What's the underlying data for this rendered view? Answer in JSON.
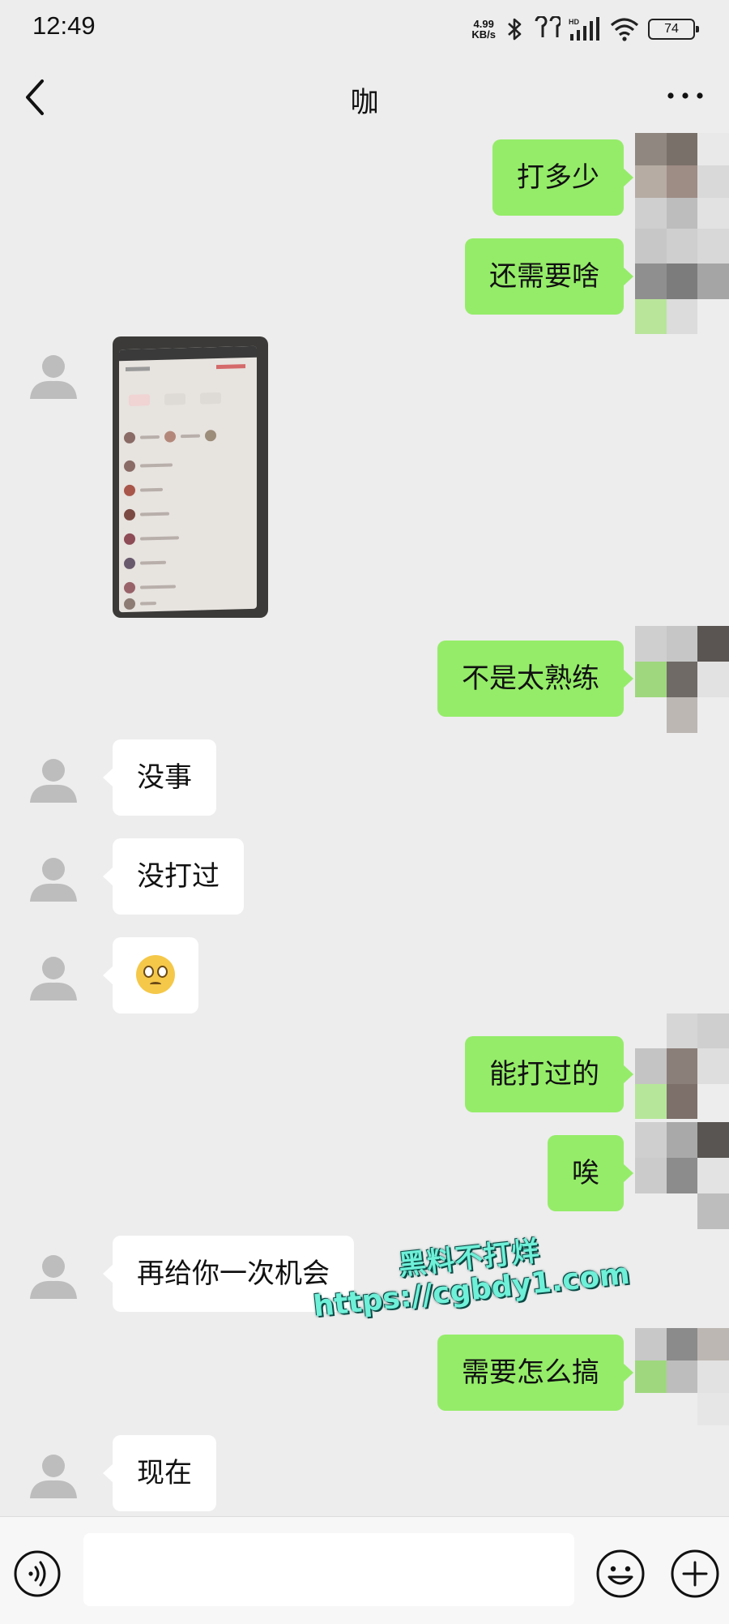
{
  "status_bar": {
    "time": "12:49",
    "net_speed_value": "4.99",
    "net_speed_unit": "KB/s",
    "battery": "74",
    "icons": [
      "bluetooth-icon",
      "earbuds-icon",
      "hd-signal-icon",
      "wifi-icon",
      "battery-icon"
    ]
  },
  "header": {
    "title": "咖",
    "back_icon": "chevron-left-icon",
    "more_icon": "more-dots-icon"
  },
  "messages": [
    {
      "side": "right",
      "type": "text",
      "text": "打多少"
    },
    {
      "side": "right",
      "type": "text",
      "text": "还需要啥"
    },
    {
      "side": "left",
      "type": "image",
      "text": ""
    },
    {
      "side": "right",
      "type": "text",
      "text": "不是太熟练"
    },
    {
      "side": "left",
      "type": "text",
      "text": "没事"
    },
    {
      "side": "left",
      "type": "text",
      "text": "没打过"
    },
    {
      "side": "left",
      "type": "emoji",
      "text": "",
      "emoji": "teary-face-emoji"
    },
    {
      "side": "right",
      "type": "text",
      "text": "能打过的"
    },
    {
      "side": "right",
      "type": "text",
      "text": "唉"
    },
    {
      "side": "left",
      "type": "text",
      "text": "再给你一次机会"
    },
    {
      "side": "right",
      "type": "text",
      "text": "需要怎么搞"
    },
    {
      "side": "left",
      "type": "text",
      "text": "现在"
    }
  ],
  "watermark": {
    "line1": "黑料不打烊",
    "line2": "https://cgbdy1.com"
  },
  "input_bar": {
    "value": "",
    "voice_icon": "voice-icon",
    "emoji_icon": "emoji-icon",
    "plus_icon": "plus-icon"
  },
  "colors": {
    "background": "#ededed",
    "outgoing_bubble": "#95ec69",
    "incoming_bubble": "#ffffff",
    "watermark": "#6ff0d8"
  }
}
